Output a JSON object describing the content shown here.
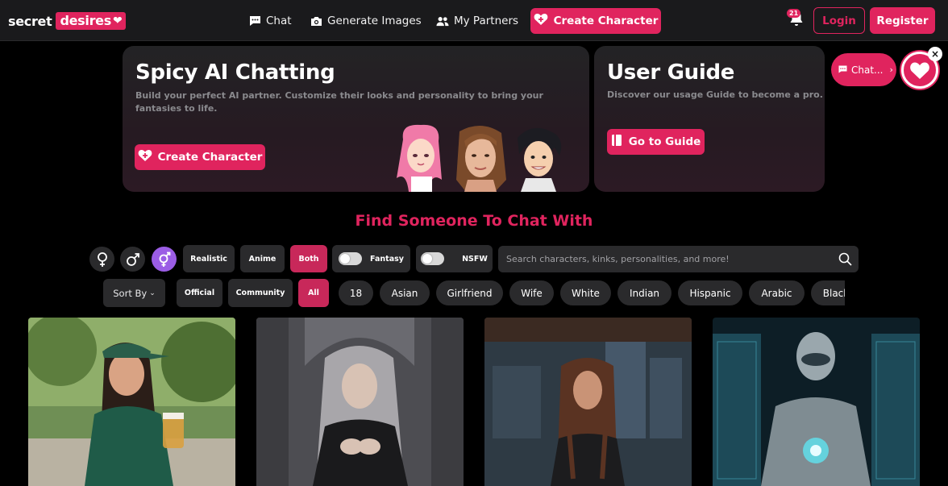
{
  "header": {
    "logo_text1": "secret",
    "logo_text2": "desires",
    "nav_chat": "Chat",
    "nav_generate": "Generate Images",
    "nav_partners": "My Partners",
    "create_character": "Create Character",
    "notification_count": "21",
    "login": "Login",
    "register": "Register"
  },
  "hero": {
    "title": "Spicy AI Chatting",
    "subtitle": "Build your perfect AI partner. Customize their looks and personality to bring your fantasies to life.",
    "button": "Create Character"
  },
  "guide": {
    "title": "User Guide",
    "subtitle": "Discover our usage Guide to become a pro.",
    "button": "Go to Guide"
  },
  "floating": {
    "chat_label": "Chat..."
  },
  "section_title": "Find Someone To Chat With",
  "filters": {
    "gender_icons": [
      "female-icon",
      "male-icon",
      "both-genders-icon"
    ],
    "style_options": [
      "Realistic",
      "Anime",
      "Both"
    ],
    "style_selected": "Both",
    "toggle_fantasy": "Fantasy",
    "toggle_nsfw": "NSFW",
    "search_placeholder": "Search characters, kinks, personalities, and more!",
    "sort_label": "Sort By",
    "source_options": [
      "Official",
      "Community",
      "All"
    ],
    "source_selected": "All",
    "tags": [
      "18",
      "Asian",
      "Girlfriend",
      "Wife",
      "White",
      "Indian",
      "Hispanic",
      "Arabic",
      "Black"
    ]
  },
  "colors": {
    "accent": "#e0245e",
    "gender_active": "#9b5de5",
    "chip_bg": "#2a2a2c"
  }
}
